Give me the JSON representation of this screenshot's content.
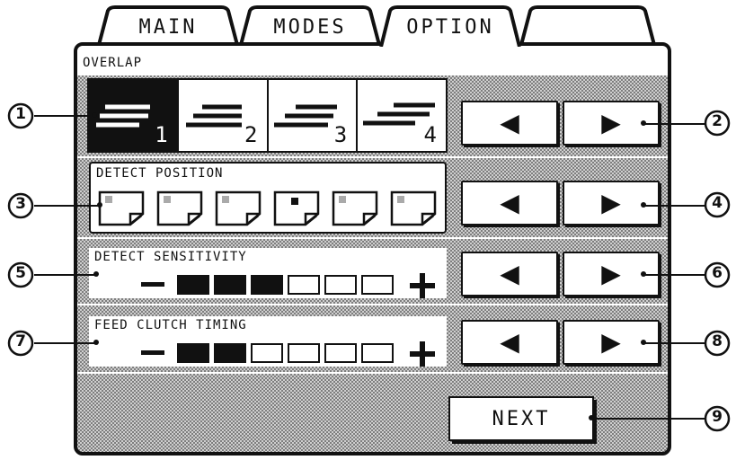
{
  "tabs": [
    {
      "label": "MAIN",
      "active": false
    },
    {
      "label": "MODES",
      "active": false
    },
    {
      "label": "OPTION",
      "active": true
    },
    {
      "label": "",
      "active": false
    }
  ],
  "overlap": {
    "title": "OVERLAP",
    "selected": 1,
    "options": [
      "1",
      "2",
      "3",
      "4"
    ]
  },
  "detect_position": {
    "title": "DETECT POSITION",
    "selected_index": 3,
    "count": 6
  },
  "detect_sensitivity": {
    "title": "DETECT SENSITIVITY",
    "level": 3,
    "segments": 6
  },
  "feed_clutch_timing": {
    "title": "FEED CLUTCH TIMING",
    "level": 2,
    "segments": 6
  },
  "buttons": {
    "left_arrow": "◀",
    "right_arrow": "▶",
    "next": "NEXT"
  },
  "callouts": [
    "1",
    "2",
    "3",
    "4",
    "5",
    "6",
    "7",
    "8",
    "9"
  ],
  "colors": {
    "ink": "#111111",
    "panel_dots": "#cfcfcf",
    "background": "#ffffff"
  }
}
